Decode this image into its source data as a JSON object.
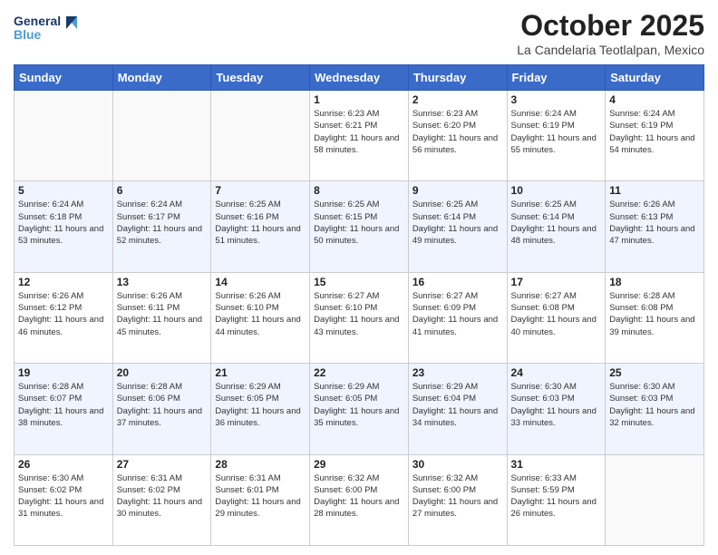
{
  "logo": {
    "line1": "General",
    "line2": "Blue"
  },
  "title": "October 2025",
  "subtitle": "La Candelaria Teotlalpan, Mexico",
  "days_of_week": [
    "Sunday",
    "Monday",
    "Tuesday",
    "Wednesday",
    "Thursday",
    "Friday",
    "Saturday"
  ],
  "weeks": [
    [
      {
        "day": "",
        "info": ""
      },
      {
        "day": "",
        "info": ""
      },
      {
        "day": "",
        "info": ""
      },
      {
        "day": "1",
        "info": "Sunrise: 6:23 AM\nSunset: 6:21 PM\nDaylight: 11 hours\nand 58 minutes."
      },
      {
        "day": "2",
        "info": "Sunrise: 6:23 AM\nSunset: 6:20 PM\nDaylight: 11 hours\nand 56 minutes."
      },
      {
        "day": "3",
        "info": "Sunrise: 6:24 AM\nSunset: 6:19 PM\nDaylight: 11 hours\nand 55 minutes."
      },
      {
        "day": "4",
        "info": "Sunrise: 6:24 AM\nSunset: 6:19 PM\nDaylight: 11 hours\nand 54 minutes."
      }
    ],
    [
      {
        "day": "5",
        "info": "Sunrise: 6:24 AM\nSunset: 6:18 PM\nDaylight: 11 hours\nand 53 minutes."
      },
      {
        "day": "6",
        "info": "Sunrise: 6:24 AM\nSunset: 6:17 PM\nDaylight: 11 hours\nand 52 minutes."
      },
      {
        "day": "7",
        "info": "Sunrise: 6:25 AM\nSunset: 6:16 PM\nDaylight: 11 hours\nand 51 minutes."
      },
      {
        "day": "8",
        "info": "Sunrise: 6:25 AM\nSunset: 6:15 PM\nDaylight: 11 hours\nand 50 minutes."
      },
      {
        "day": "9",
        "info": "Sunrise: 6:25 AM\nSunset: 6:14 PM\nDaylight: 11 hours\nand 49 minutes."
      },
      {
        "day": "10",
        "info": "Sunrise: 6:25 AM\nSunset: 6:14 PM\nDaylight: 11 hours\nand 48 minutes."
      },
      {
        "day": "11",
        "info": "Sunrise: 6:26 AM\nSunset: 6:13 PM\nDaylight: 11 hours\nand 47 minutes."
      }
    ],
    [
      {
        "day": "12",
        "info": "Sunrise: 6:26 AM\nSunset: 6:12 PM\nDaylight: 11 hours\nand 46 minutes."
      },
      {
        "day": "13",
        "info": "Sunrise: 6:26 AM\nSunset: 6:11 PM\nDaylight: 11 hours\nand 45 minutes."
      },
      {
        "day": "14",
        "info": "Sunrise: 6:26 AM\nSunset: 6:10 PM\nDaylight: 11 hours\nand 44 minutes."
      },
      {
        "day": "15",
        "info": "Sunrise: 6:27 AM\nSunset: 6:10 PM\nDaylight: 11 hours\nand 43 minutes."
      },
      {
        "day": "16",
        "info": "Sunrise: 6:27 AM\nSunset: 6:09 PM\nDaylight: 11 hours\nand 41 minutes."
      },
      {
        "day": "17",
        "info": "Sunrise: 6:27 AM\nSunset: 6:08 PM\nDaylight: 11 hours\nand 40 minutes."
      },
      {
        "day": "18",
        "info": "Sunrise: 6:28 AM\nSunset: 6:08 PM\nDaylight: 11 hours\nand 39 minutes."
      }
    ],
    [
      {
        "day": "19",
        "info": "Sunrise: 6:28 AM\nSunset: 6:07 PM\nDaylight: 11 hours\nand 38 minutes."
      },
      {
        "day": "20",
        "info": "Sunrise: 6:28 AM\nSunset: 6:06 PM\nDaylight: 11 hours\nand 37 minutes."
      },
      {
        "day": "21",
        "info": "Sunrise: 6:29 AM\nSunset: 6:05 PM\nDaylight: 11 hours\nand 36 minutes."
      },
      {
        "day": "22",
        "info": "Sunrise: 6:29 AM\nSunset: 6:05 PM\nDaylight: 11 hours\nand 35 minutes."
      },
      {
        "day": "23",
        "info": "Sunrise: 6:29 AM\nSunset: 6:04 PM\nDaylight: 11 hours\nand 34 minutes."
      },
      {
        "day": "24",
        "info": "Sunrise: 6:30 AM\nSunset: 6:03 PM\nDaylight: 11 hours\nand 33 minutes."
      },
      {
        "day": "25",
        "info": "Sunrise: 6:30 AM\nSunset: 6:03 PM\nDaylight: 11 hours\nand 32 minutes."
      }
    ],
    [
      {
        "day": "26",
        "info": "Sunrise: 6:30 AM\nSunset: 6:02 PM\nDaylight: 11 hours\nand 31 minutes."
      },
      {
        "day": "27",
        "info": "Sunrise: 6:31 AM\nSunset: 6:02 PM\nDaylight: 11 hours\nand 30 minutes."
      },
      {
        "day": "28",
        "info": "Sunrise: 6:31 AM\nSunset: 6:01 PM\nDaylight: 11 hours\nand 29 minutes."
      },
      {
        "day": "29",
        "info": "Sunrise: 6:32 AM\nSunset: 6:00 PM\nDaylight: 11 hours\nand 28 minutes."
      },
      {
        "day": "30",
        "info": "Sunrise: 6:32 AM\nSunset: 6:00 PM\nDaylight: 11 hours\nand 27 minutes."
      },
      {
        "day": "31",
        "info": "Sunrise: 6:33 AM\nSunset: 5:59 PM\nDaylight: 11 hours\nand 26 minutes."
      },
      {
        "day": "",
        "info": ""
      }
    ]
  ]
}
